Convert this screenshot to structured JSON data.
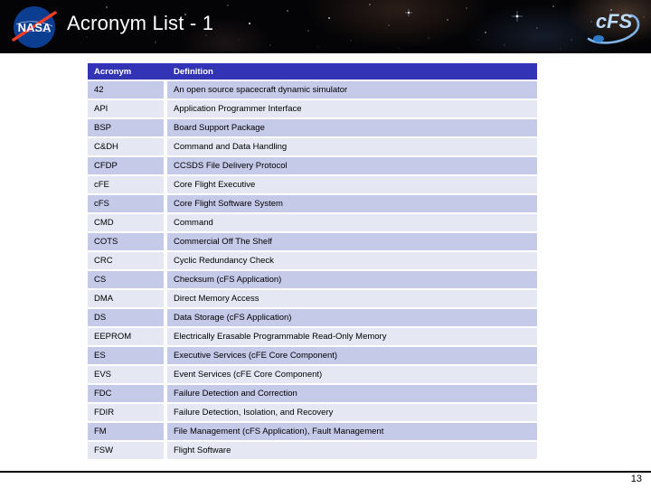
{
  "slide": {
    "title": "Acronym List - 1",
    "page_number": "13",
    "nasa_logo_text": "NASA",
    "cfs_logo_text": "cFS",
    "accent_color": "#3333b5",
    "row_band_a_color": "#c6cae9",
    "row_band_b_color": "#e5e7f3",
    "banner_color": "#040406",
    "title_color": "#ffffff"
  },
  "table": {
    "columns": [
      "Acronym",
      "Definition"
    ],
    "rows": [
      {
        "acronym": "42",
        "definition": "An open source spacecraft dynamic simulator"
      },
      {
        "acronym": "API",
        "definition": "Application Programmer Interface"
      },
      {
        "acronym": "BSP",
        "definition": "Board Support Package"
      },
      {
        "acronym": "C&DH",
        "definition": "Command and Data Handling"
      },
      {
        "acronym": "CFDP",
        "definition": "CCSDS File Delivery Protocol"
      },
      {
        "acronym": "cFE",
        "definition": "Core Flight Executive"
      },
      {
        "acronym": "cFS",
        "definition": "Core Flight Software System"
      },
      {
        "acronym": "CMD",
        "definition": "Command"
      },
      {
        "acronym": "COTS",
        "definition": "Commercial Off The Shelf"
      },
      {
        "acronym": "CRC",
        "definition": "Cyclic Redundancy Check"
      },
      {
        "acronym": "CS",
        "definition": "Checksum (cFS Application)"
      },
      {
        "acronym": "DMA",
        "definition": "Direct Memory Access"
      },
      {
        "acronym": "DS",
        "definition": "Data Storage (cFS Application)"
      },
      {
        "acronym": "EEPROM",
        "definition": "Electrically Erasable Programmable Read-Only Memory"
      },
      {
        "acronym": "ES",
        "definition": "Executive Services (cFE Core Component)"
      },
      {
        "acronym": "EVS",
        "definition": "Event Services (cFE Core Component)"
      },
      {
        "acronym": "FDC",
        "definition": "Failure Detection and Correction"
      },
      {
        "acronym": "FDIR",
        "definition": "Failure Detection, Isolation, and Recovery"
      },
      {
        "acronym": "FM",
        "definition": "File Management (cFS Application), Fault Management"
      },
      {
        "acronym": "FSW",
        "definition": "Flight Software"
      }
    ]
  }
}
